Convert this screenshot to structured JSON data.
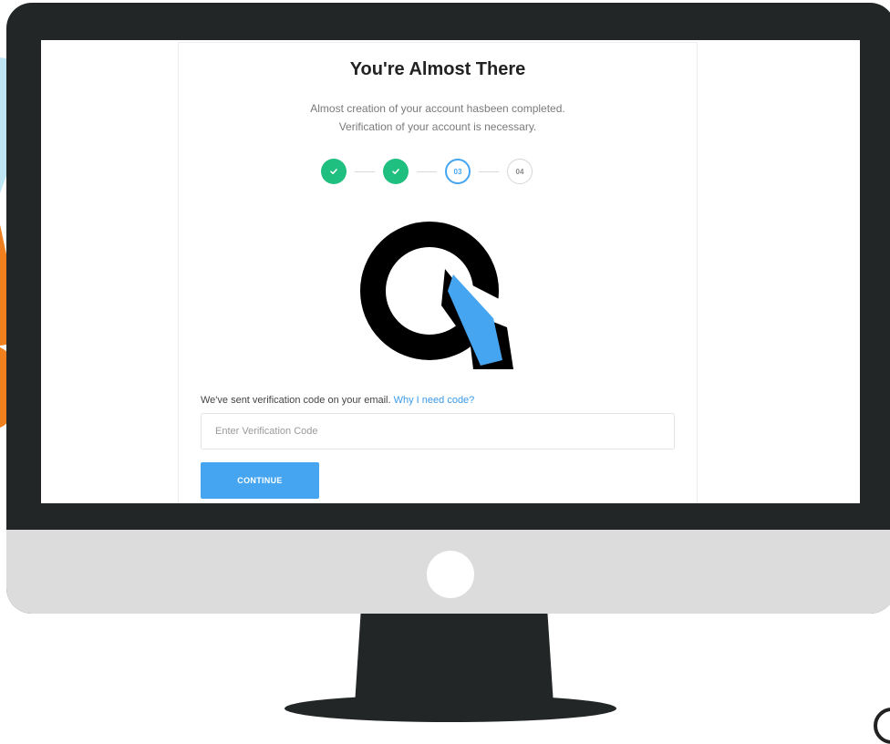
{
  "page": {
    "title": "You're Almost There",
    "subtitle_line1": "Almost creation of your account hasbeen completed.",
    "subtitle_line2": "Verification of your account is necessary."
  },
  "steps": [
    {
      "label": "",
      "status": "done",
      "icon": "check-icon"
    },
    {
      "label": "",
      "status": "done",
      "icon": "check-icon"
    },
    {
      "label": "03",
      "status": "active"
    },
    {
      "label": "04",
      "status": "pending"
    }
  ],
  "verification": {
    "info_text": "We've sent verification code on your email.",
    "link_text": "Why I need code?",
    "input_value": "",
    "input_placeholder": "Enter Verification Code"
  },
  "actions": {
    "continue_label": "CONTINUE"
  },
  "colors": {
    "accent": "#45a5f0",
    "success": "#1fbf80",
    "monitor_frame": "#222626",
    "monitor_chin": "#dcdcdc"
  },
  "logo": {
    "name": "q-arrow-logo"
  }
}
